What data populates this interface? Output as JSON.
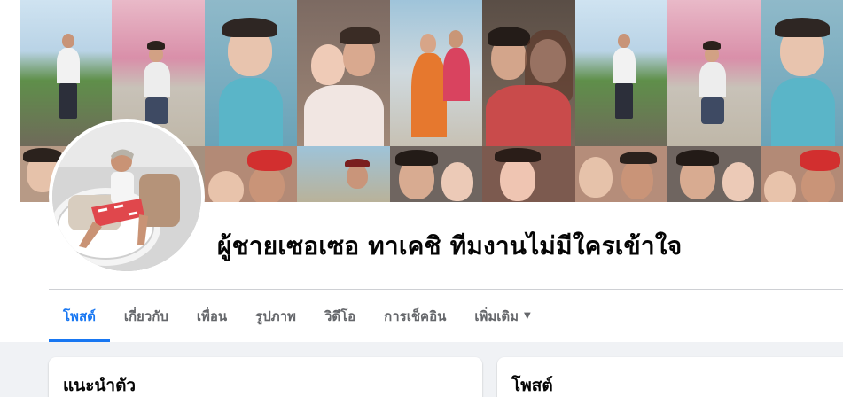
{
  "profile": {
    "name": "ผู้ชายเซอเซอ ทาเคชิ ทีมงานไม่มีใครเข้าใจ"
  },
  "tabs": [
    {
      "label": "โพสต์"
    },
    {
      "label": "เกี่ยวกับ"
    },
    {
      "label": "เพื่อน"
    },
    {
      "label": "รูปภาพ"
    },
    {
      "label": "วิดีโอ"
    },
    {
      "label": "การเช็คอิน"
    },
    {
      "label": "เพิ่มเติม"
    }
  ],
  "cards": {
    "intro_title": "แนะนำตัว",
    "posts_title": "โพสต์"
  },
  "colors": {
    "accent": "#1877f2",
    "page_bg": "#f0f2f5",
    "tab_text": "#65676b"
  }
}
